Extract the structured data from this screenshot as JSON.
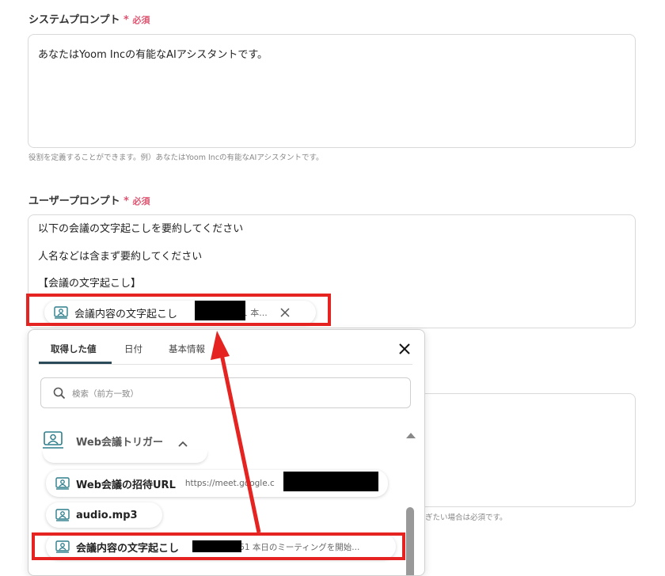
{
  "system_prompt": {
    "label": "システムプロンプト",
    "asterisk": "*",
    "required": "必須",
    "value": "あなたはYoom Incの有能なAIアシスタントです。",
    "hint": "役割を定義することができます。例）あなたはYoom Incの有能なAIアシスタントです。"
  },
  "user_prompt": {
    "label": "ユーザープロンプト",
    "asterisk": "*",
    "required": "必須",
    "lines": [
      "以下の会議の文字起こしを要約してください",
      "人名などは含まず要約してください",
      "【会議の文字起こし】"
    ],
    "token": {
      "name": "会議内容の文字起こし",
      "meta": "2:51 本..."
    }
  },
  "popup": {
    "tabs": [
      "取得した値",
      "日付",
      "基本情報"
    ],
    "search_placeholder": "検索（前方一致）",
    "group_title": "Web会議トリガー",
    "items": [
      {
        "name": "Web会議の招待URL",
        "meta": "https://meet.google.c"
      },
      {
        "name": "audio.mp3",
        "meta": ""
      },
      {
        "name": "会議内容の文字起こし",
        "meta": "2:51 本日のミーティングを開始..."
      }
    ]
  },
  "background_hint_fragment": "ぎたい場合は必須です。",
  "colors": {
    "required": "#e05470",
    "highlight": "#e52421",
    "tab_underline": "#2b4a5a",
    "icon": "#2e7e8c"
  }
}
